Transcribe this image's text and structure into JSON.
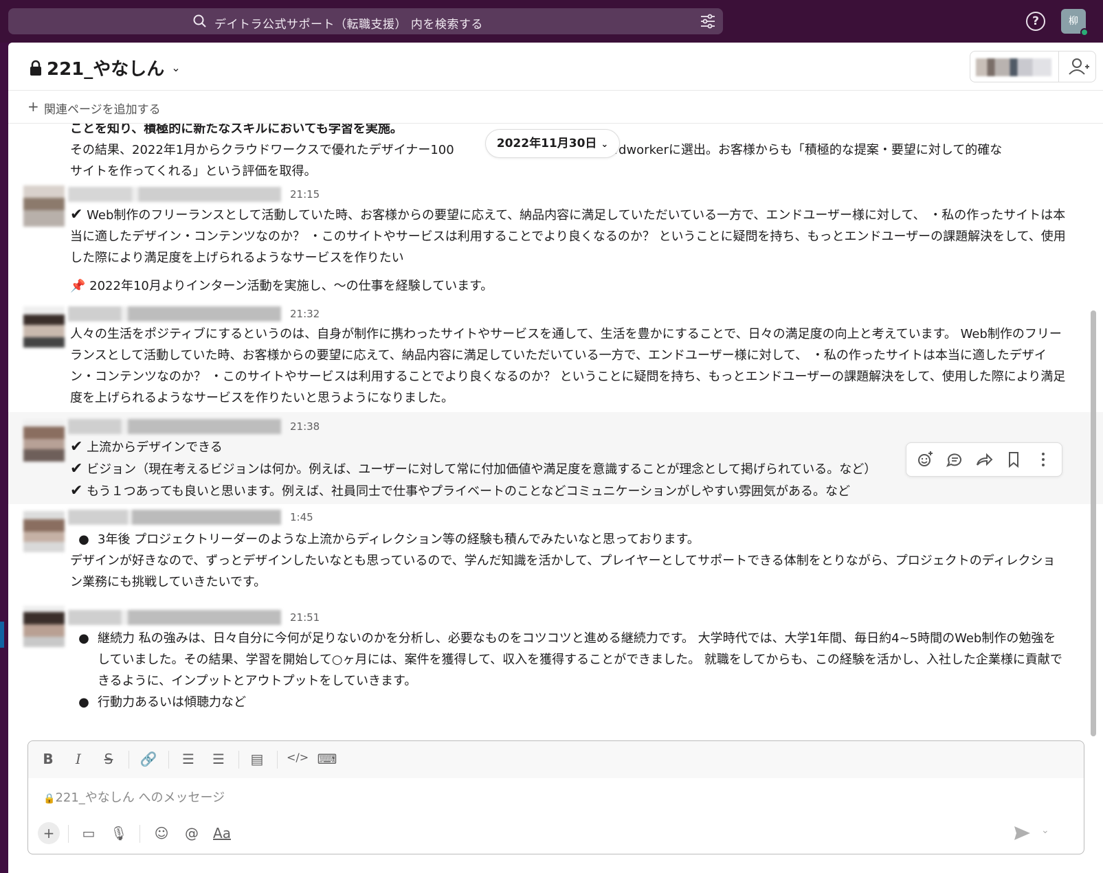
{
  "search": {
    "placeholder": "デイトラ公式サポート（転職支援） 内を検索する"
  },
  "user": {
    "avatar_initial": "柳"
  },
  "channel": {
    "name": "221_やなしん"
  },
  "bookmarks": {
    "add_label": "関連ページを追加する"
  },
  "date_divider": "2022年11月30日",
  "messages": [
    {
      "time": "",
      "lines": [
        "ことを知り、積極的に新たなスキルにおいても学習を実施。",
        "その結果、2022年1月からクラウドワークスで優れたデザイナー100",
        "Crowdworkerに選出。お客様からも「積極的な提案・要望に対して的確な",
        "サイトを作ってくれる」という評価を取得。"
      ]
    },
    {
      "time": "21:15",
      "check_text": "Web制作のフリーランスとして活動していた時、お客様からの要望に応えて、納品内容に満足していただいている一方で、エンドユーザー様に対して、 ・私の作ったサイトは本当に適したデザイン・コンテンツなのか？ ・このサイトやサービスは利用することでより良くなるのか？ ということに疑問を持ち、もっとエンドユーザーの課題解決をして、使用した際により満足度を上げられるようなサービスを作りたい",
      "pin_text": "2022年10月よりインターン活動を実施し、〜の仕事を経験しています。"
    },
    {
      "time": "21:32",
      "text": "人々の生活をポジティブにするというのは、自身が制作に携わったサイトやサービスを通して、生活を豊かにすることで、日々の満足度の向上と考えています。 Web制作のフリーランスとして活動していた時、お客様からの要望に応えて、納品内容に満足していただいている一方で、エンドユーザー様に対して、 ・私の作ったサイトは本当に適したデザイン・コンテンツなのか？ ・このサイトやサービスは利用することでより良くなるのか？ ということに疑問を持ち、もっとエンドユーザーの課題解決をして、使用した際により満足度を上げられるようなサービスを作りたいと思うようになりました。"
    },
    {
      "time": "21:38",
      "checks": [
        "上流からデザインできる",
        "ビジョン（現在考えるビジョンは何か。例えば、ユーザーに対して常に付加価値や満足度を意識することが理念として掲げられている。など）",
        "もう１つあっても良いと思います。例えば、社員同士で仕事やプライベートのことなどコミュニケーションがしやすい雰囲気がある。など"
      ]
    },
    {
      "time": "1:45",
      "bullet": "3年後 プロジェクトリーダーのような上流からディレクション等の経験も積んでみたいなと思っております。",
      "text": "デザインが好きなので、ずっとデザインしたいなとも思っているので、学んだ知識を活かして、プレイヤーとしてサポートできる体制をとりながら、プロジェクトのディレクション業務にも挑戦していきたいです。"
    },
    {
      "time": "21:51",
      "bullets": [
        "継続力 私の強みは、日々自分に今何が足りないのかを分析し、必要なものをコツコツと進める継続力です。 大学時代では、大学1年間、毎日約4~5時間のWeb制作の勉強をしていました。その結果、学習を開始して○ヶ月には、案件を獲得して、収入を獲得することができました。 就職をしてからも、この経験を活かし、入社した企業様に貢献できるように、インプットとアウトプットをしていきます。",
        "行動力あるいは傾聴力など"
      ]
    }
  ],
  "composer": {
    "placeholder": "221_やなしん へのメッセージ",
    "format_label": "Aa"
  }
}
